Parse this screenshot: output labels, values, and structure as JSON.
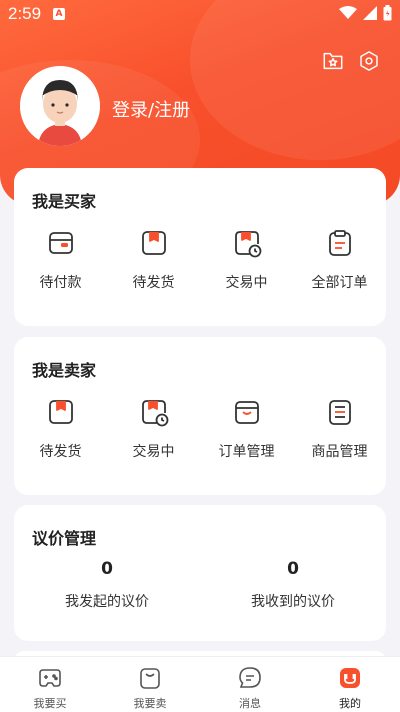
{
  "status_bar": {
    "time": "2:59",
    "notif_badge": "A"
  },
  "header": {
    "login_label": "登录/注册",
    "icons": [
      "star-folder-icon",
      "settings-icon"
    ]
  },
  "buyer": {
    "title": "我是买家",
    "items": [
      {
        "label": "待付款",
        "icon": "wallet-icon"
      },
      {
        "label": "待发货",
        "icon": "package-icon"
      },
      {
        "label": "交易中",
        "icon": "package-clock-icon"
      },
      {
        "label": "全部订单",
        "icon": "clipboard-icon"
      }
    ]
  },
  "seller": {
    "title": "我是卖家",
    "items": [
      {
        "label": "待发货",
        "icon": "package-icon"
      },
      {
        "label": "交易中",
        "icon": "package-clock-icon"
      },
      {
        "label": "订单管理",
        "icon": "box-icon"
      },
      {
        "label": "商品管理",
        "icon": "list-doc-icon"
      }
    ]
  },
  "bargain": {
    "title": "议价管理",
    "sent_count": "0",
    "sent_label": "我发起的议价",
    "received_count": "0",
    "received_label": "我收到的议价"
  },
  "tabbar": {
    "items": [
      {
        "label": "我要买",
        "icon": "gamepad-icon"
      },
      {
        "label": "我要卖",
        "icon": "bag-icon"
      },
      {
        "label": "消息",
        "icon": "chat-icon"
      },
      {
        "label": "我的",
        "icon": "profile-icon"
      }
    ],
    "active_index": 3
  },
  "colors": {
    "accent": "#f8502c",
    "background": "#f4f4f8"
  }
}
